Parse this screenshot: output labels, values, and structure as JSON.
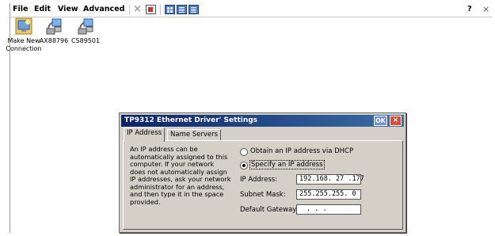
{
  "menubar": {
    "file": "File",
    "edit": "Edit",
    "view": "View",
    "advanced": "Advanced",
    "help_glyph": "?",
    "close_glyph": "×"
  },
  "desktop": {
    "icons": [
      {
        "label_line1": "Make New",
        "label_line2": "Connection",
        "icon": "make-new-connection-icon"
      },
      {
        "label_line1": "AX88796",
        "label_line2": "",
        "icon": "network-connection-icon"
      },
      {
        "label_line1": "CS89501",
        "label_line2": "",
        "icon": "network-connection-icon"
      }
    ]
  },
  "dialog": {
    "title": "TP9312 Ethernet Driver' Settings",
    "ok_label": "OK",
    "close_label": "×",
    "tabs": [
      {
        "label": "IP Address",
        "active": true
      },
      {
        "label": "Name Servers",
        "active": false
      }
    ],
    "description_lines": [
      "An IP address can be",
      "automatically assigned to this",
      "computer.  If your network",
      "does not automatically assign",
      "IP addresses, ask your network",
      "administrator for an address,",
      "and then type it in the space",
      "provided."
    ],
    "radio_dhcp": "Obtain an IP address via DHCP",
    "radio_specify": "Specify an IP address",
    "selected_radio": "specify",
    "ip_label": "IP Address:",
    "ip_value": "192.168. 27 .177",
    "subnet_label": "Subnet Mask:",
    "subnet_value": "255.255.255. 0",
    "gateway_label": "Default Gateway:",
    "gateway_value": ".   .   ."
  },
  "colors": {
    "titlebar_start": "#0a246a",
    "titlebar_end": "#3a6ea5",
    "dialog_face": "#d4d0c8",
    "close_red": "#d94b3a"
  }
}
